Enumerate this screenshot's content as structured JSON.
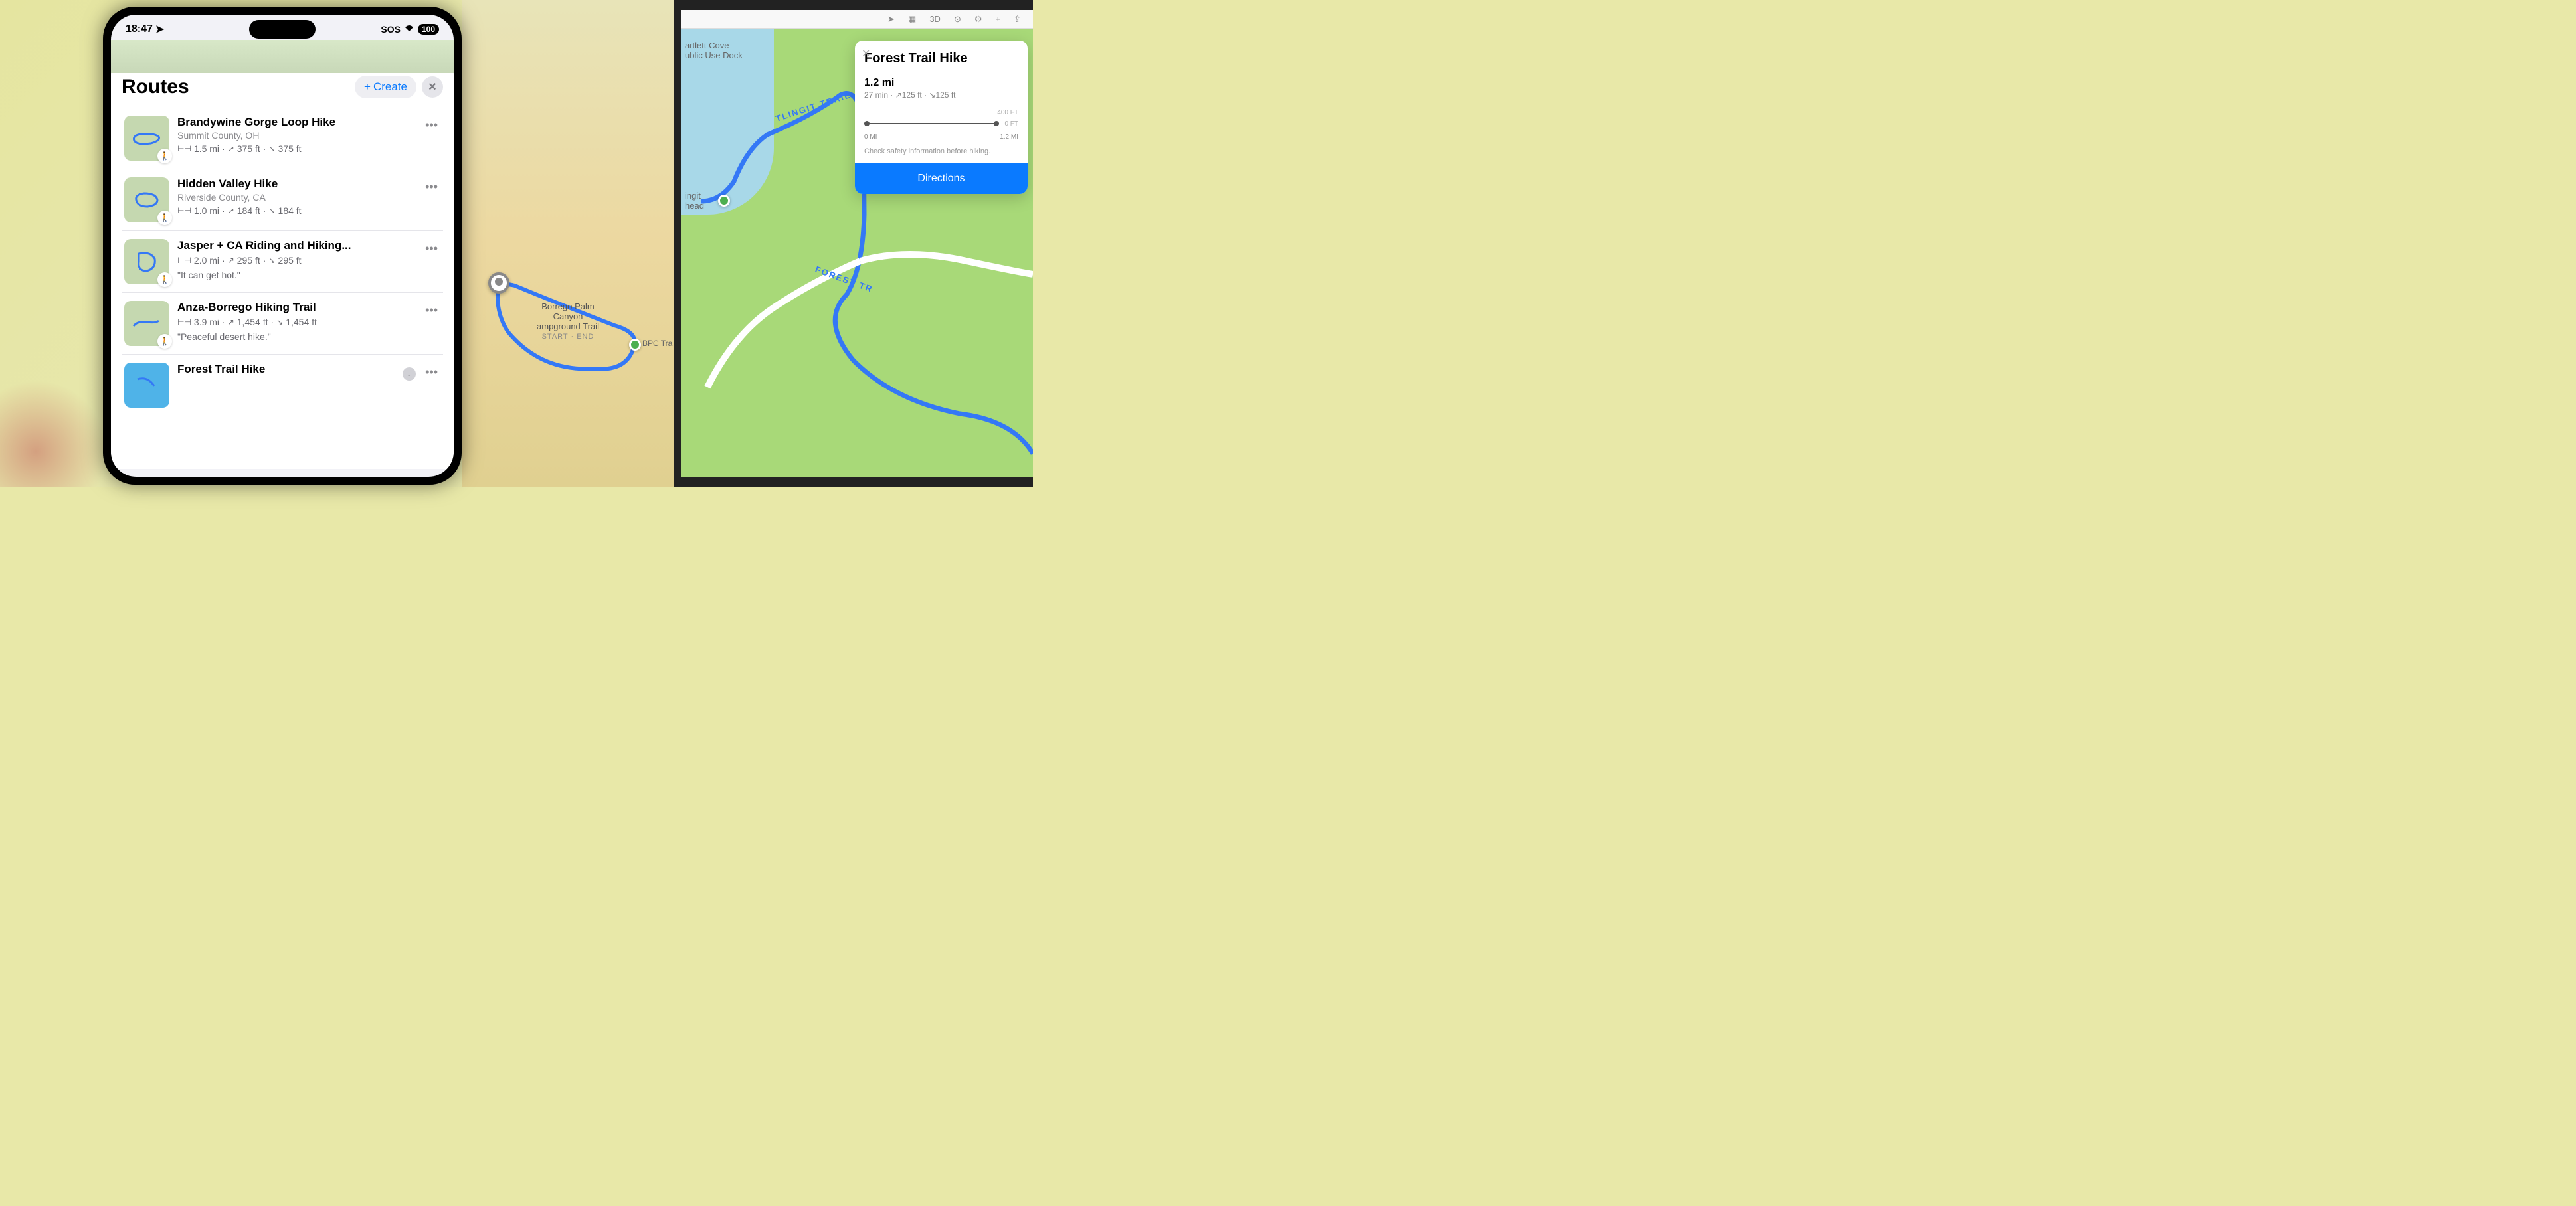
{
  "phone": {
    "status": {
      "time": "18:47",
      "sos": "SOS",
      "battery": "100"
    },
    "sheet": {
      "title": "Routes",
      "create_label": "Create"
    },
    "routes": [
      {
        "title": "Brandywine Gorge Loop Hike",
        "subtitle": "Summit County, OH",
        "distance": "1.5 mi",
        "ascent": "375 ft",
        "descent": "375 ft",
        "note": ""
      },
      {
        "title": "Hidden Valley Hike",
        "subtitle": "Riverside County, CA",
        "distance": "1.0 mi",
        "ascent": "184 ft",
        "descent": "184 ft",
        "note": ""
      },
      {
        "title": "Jasper + CA Riding and Hiking...",
        "subtitle": "",
        "distance": "2.0 mi",
        "ascent": "295 ft",
        "descent": "295 ft",
        "note": "\"It can get hot.\""
      },
      {
        "title": "Anza-Borrego Hiking Trail",
        "subtitle": "",
        "distance": "3.9 mi",
        "ascent": "1,454 ft",
        "descent": "1,454 ft",
        "note": "\"Peaceful desert hike.\""
      },
      {
        "title": "Forest Trail Hike",
        "subtitle": "",
        "distance": "",
        "ascent": "",
        "descent": "",
        "note": ""
      }
    ]
  },
  "mid_map": {
    "place_line1": "Borrego Palm",
    "place_line2": "Canyon",
    "place_line3": "ampground Trail",
    "start_end": "START · END",
    "poi_label": "BPC Tra"
  },
  "ipad": {
    "toolbar": {
      "mode3d": "3D"
    },
    "map_labels": {
      "dock1": "artlett Cove",
      "dock2": "ublic Use Dock",
      "th1": "ingit",
      "th2": "head",
      "trail1": "TLINGIT TRAIL",
      "trail2": "FOREST TR"
    },
    "detail": {
      "title": "Forest Trail Hike",
      "distance": "1.2 mi",
      "stats": "27 min · ↗125 ft · ↘125 ft",
      "elev_top": "400 FT",
      "elev_zero": "0 FT",
      "axis_start": "0 MI",
      "axis_end": "1.2 MI",
      "safety": "Check safety information before hiking.",
      "directions_label": "Directions"
    }
  }
}
